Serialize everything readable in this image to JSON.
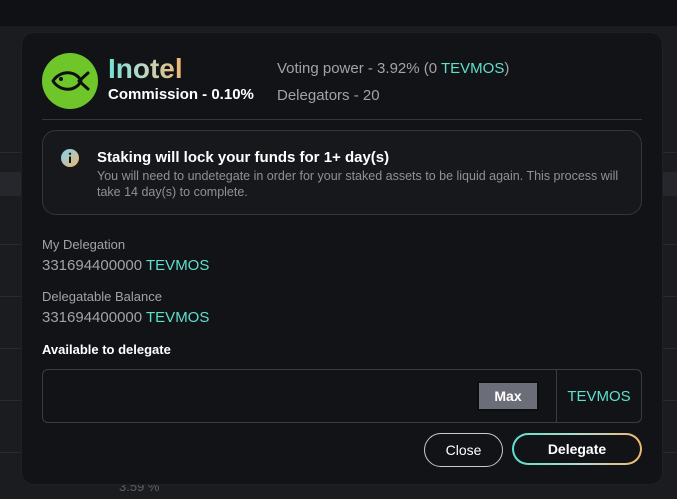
{
  "background": {
    "partial_value": "3.59 %"
  },
  "validator": {
    "name": "Inotel",
    "commission": "Commission - 0.10%",
    "voting_power_prefix": "Voting power - 3.92% (0 ",
    "voting_power_denom": "TEVMOS",
    "voting_power_suffix": ")",
    "delegators": "Delegators - 20"
  },
  "notice": {
    "title": "Staking will lock your funds for 1+ day(s)",
    "body": "You will need to undetegate in order for your staked assets to be liquid again. This process will take 14 day(s) to complete."
  },
  "my_delegation": {
    "label": "My Delegation",
    "amount": "331694400000",
    "denom": "TEVMOS"
  },
  "delegatable_balance": {
    "label": "Delegatable Balance",
    "amount": "331694400000",
    "denom": "TEVMOS"
  },
  "amount_input": {
    "label": "Available to delegate",
    "value": "",
    "max_label": "Max",
    "denom": "TEVMOS"
  },
  "actions": {
    "close_label": "Close",
    "delegate_label": "Delegate"
  },
  "colors": {
    "accent": "#5ee0cc",
    "logo_bg": "#6fc62a",
    "modal_bg": "#121317"
  },
  "icons": {
    "logo": "fish-icon",
    "notice": "info-icon"
  }
}
